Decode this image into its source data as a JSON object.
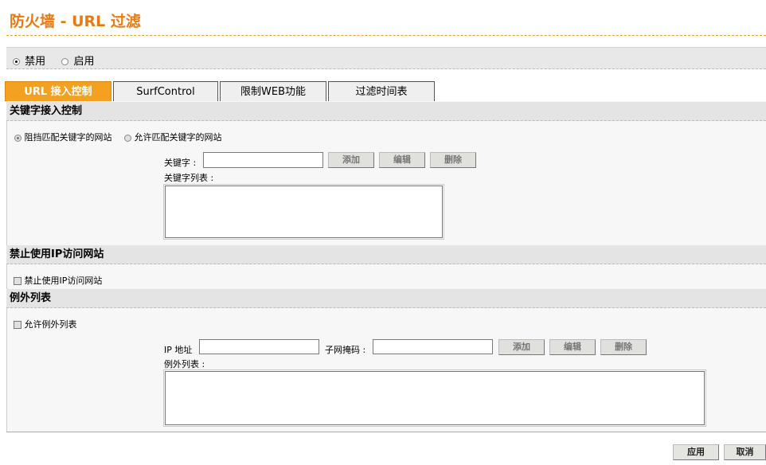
{
  "header": {
    "title": "防火墙  - URL 过滤"
  },
  "status": {
    "disable_label": "禁用",
    "enable_label": "启用",
    "selected": "disable"
  },
  "tabs": [
    {
      "label": "URL 接入控制",
      "active": true
    },
    {
      "label": "SurfControl",
      "active": false
    },
    {
      "label": "限制WEB功能",
      "active": false
    },
    {
      "label": "过滤时间表",
      "active": false
    }
  ],
  "keyword_section": {
    "title": "关键字接入控制",
    "block_label": "阻挡匹配关键字的网站",
    "allow_label": "允许匹配关键字的网站",
    "keyword_label": "关键字 :",
    "keyword_value": "",
    "list_label": "关键字列表 :",
    "add": "添加",
    "edit": "编辑",
    "delete": "删除"
  },
  "ip_section": {
    "title": "禁止使用IP访问网站",
    "checkbox_label": "禁止使用IP访问网站"
  },
  "exception_section": {
    "title": "例外列表",
    "checkbox_label": "允许例外列表",
    "ip_label": "IP 地址",
    "ip_value": "",
    "mask_label": "子网掩码 :",
    "mask_value": "",
    "list_label": "例外列表 :",
    "add": "添加",
    "edit": "编辑",
    "delete": "删除"
  },
  "footer": {
    "apply": "应用",
    "cancel": "取消"
  },
  "colors": {
    "accent": "#f4a020",
    "title": "#e87a10"
  }
}
